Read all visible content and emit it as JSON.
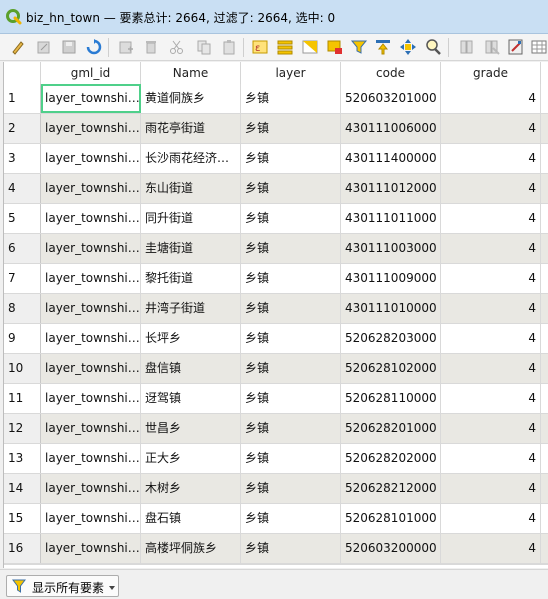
{
  "window": {
    "title": "biz_hn_town — 要素总计: 2664, 过滤了: 2664, 选中: 0"
  },
  "toolbar": {
    "buttons": [
      {
        "name": "toggle-editing-icon"
      },
      {
        "name": "toggle-multi-edit-icon"
      },
      {
        "name": "save-edits-icon"
      },
      {
        "name": "reload-table-icon"
      },
      {
        "name": "add-feature-icon"
      },
      {
        "name": "delete-selected-icon"
      },
      {
        "name": "cut-icon"
      },
      {
        "name": "copy-icon"
      },
      {
        "name": "paste-icon"
      },
      {
        "name": "select-by-expression-icon"
      },
      {
        "name": "select-all-icon"
      },
      {
        "name": "invert-selection-icon"
      },
      {
        "name": "deselect-all-icon"
      },
      {
        "name": "filter-select-icon"
      },
      {
        "name": "move-selection-to-top-icon"
      },
      {
        "name": "pan-to-selected-icon"
      },
      {
        "name": "zoom-to-selected-icon"
      },
      {
        "name": "new-field-icon"
      },
      {
        "name": "delete-field-icon"
      },
      {
        "name": "field-calculator-icon"
      },
      {
        "name": "conditional-formatting-icon"
      }
    ]
  },
  "table": {
    "columns": [
      "gml_id",
      "Name",
      "layer",
      "code",
      "grade"
    ],
    "rows": [
      {
        "n": "1",
        "gml_id": "layer_townshi…",
        "name": "黄道侗族乡",
        "layer": "乡镇",
        "code": "520603201000",
        "grade": "4"
      },
      {
        "n": "2",
        "gml_id": "layer_townshi…",
        "name": "雨花亭街道",
        "layer": "乡镇",
        "code": "430111006000",
        "grade": "4"
      },
      {
        "n": "3",
        "gml_id": "layer_townshi…",
        "name": "长沙雨花经济…",
        "layer": "乡镇",
        "code": "430111400000",
        "grade": "4"
      },
      {
        "n": "4",
        "gml_id": "layer_townshi…",
        "name": "东山街道",
        "layer": "乡镇",
        "code": "430111012000",
        "grade": "4"
      },
      {
        "n": "5",
        "gml_id": "layer_townshi…",
        "name": "同升街道",
        "layer": "乡镇",
        "code": "430111011000",
        "grade": "4"
      },
      {
        "n": "6",
        "gml_id": "layer_townshi…",
        "name": "圭塘街道",
        "layer": "乡镇",
        "code": "430111003000",
        "grade": "4"
      },
      {
        "n": "7",
        "gml_id": "layer_townshi…",
        "name": "黎托街道",
        "layer": "乡镇",
        "code": "430111009000",
        "grade": "4"
      },
      {
        "n": "8",
        "gml_id": "layer_townshi…",
        "name": "井湾子街道",
        "layer": "乡镇",
        "code": "430111010000",
        "grade": "4"
      },
      {
        "n": "9",
        "gml_id": "layer_townshi…",
        "name": "长坪乡",
        "layer": "乡镇",
        "code": "520628203000",
        "grade": "4"
      },
      {
        "n": "10",
        "gml_id": "layer_townshi…",
        "name": "盘信镇",
        "layer": "乡镇",
        "code": "520628102000",
        "grade": "4"
      },
      {
        "n": "11",
        "gml_id": "layer_townshi…",
        "name": "迓驾镇",
        "layer": "乡镇",
        "code": "520628110000",
        "grade": "4"
      },
      {
        "n": "12",
        "gml_id": "layer_townshi…",
        "name": "世昌乡",
        "layer": "乡镇",
        "code": "520628201000",
        "grade": "4"
      },
      {
        "n": "13",
        "gml_id": "layer_townshi…",
        "name": "正大乡",
        "layer": "乡镇",
        "code": "520628202000",
        "grade": "4"
      },
      {
        "n": "14",
        "gml_id": "layer_townshi…",
        "name": "木树乡",
        "layer": "乡镇",
        "code": "520628212000",
        "grade": "4"
      },
      {
        "n": "15",
        "gml_id": "layer_townshi…",
        "name": "盘石镇",
        "layer": "乡镇",
        "code": "520628101000",
        "grade": "4"
      },
      {
        "n": "16",
        "gml_id": "layer_townshi…",
        "name": "高楼坪侗族乡",
        "layer": "乡镇",
        "code": "520603200000",
        "grade": "4"
      }
    ]
  },
  "footer": {
    "filter_label": "显示所有要素"
  },
  "colors": {
    "titlebar": "#c9dff3",
    "row_alt": "#e9e8e3",
    "selection_outline": "#4fd08a"
  }
}
